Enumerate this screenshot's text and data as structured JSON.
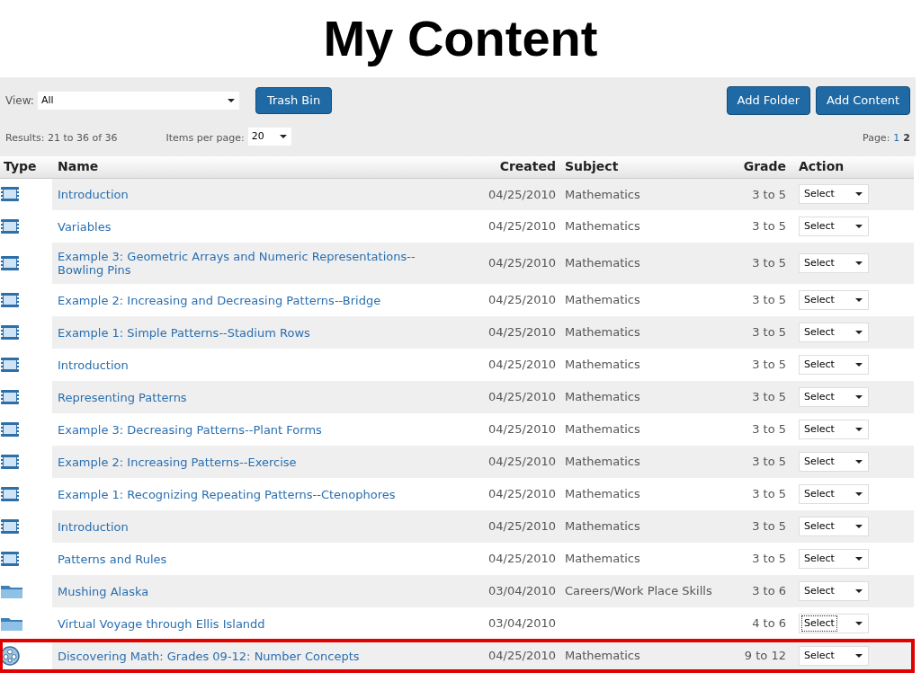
{
  "title": "My Content",
  "toolbar": {
    "view_label": "View:",
    "view_value": "All",
    "trash_button": "Trash Bin",
    "add_folder_button": "Add Folder",
    "add_content_button": "Add Content"
  },
  "results": {
    "text": "Results: 21 to 36 of 36",
    "per_page_label": "Items per page:",
    "per_page_value": "20",
    "page_label": "Page:",
    "pages": [
      {
        "label": "1",
        "selected": false
      },
      {
        "label": "2",
        "selected": true
      }
    ]
  },
  "table": {
    "columns": [
      "Type",
      "Name",
      "Created",
      "Subject",
      "Grade",
      "Action"
    ],
    "rows": [
      {
        "kind": "video",
        "name": "Introduction",
        "created": "04/25/2010",
        "subject": "Mathematics",
        "grade": "3 to 5",
        "action": "Select",
        "focused": false,
        "highlighted": false
      },
      {
        "kind": "video",
        "name": "Variables",
        "created": "04/25/2010",
        "subject": "Mathematics",
        "grade": "3 to 5",
        "action": "Select",
        "focused": false,
        "highlighted": false
      },
      {
        "kind": "video",
        "name": "Example 3: Geometric Arrays and Numeric Representations--Bowling Pins",
        "created": "04/25/2010",
        "subject": "Mathematics",
        "grade": "3 to 5",
        "action": "Select",
        "focused": false,
        "highlighted": false
      },
      {
        "kind": "video",
        "name": "Example 2: Increasing and Decreasing Patterns--Bridge",
        "created": "04/25/2010",
        "subject": "Mathematics",
        "grade": "3 to 5",
        "action": "Select",
        "focused": false,
        "highlighted": false
      },
      {
        "kind": "video",
        "name": "Example 1: Simple Patterns--Stadium Rows",
        "created": "04/25/2010",
        "subject": "Mathematics",
        "grade": "3 to 5",
        "action": "Select",
        "focused": false,
        "highlighted": false
      },
      {
        "kind": "video",
        "name": "Introduction",
        "created": "04/25/2010",
        "subject": "Mathematics",
        "grade": "3 to 5",
        "action": "Select",
        "focused": false,
        "highlighted": false
      },
      {
        "kind": "video",
        "name": "Representing Patterns",
        "created": "04/25/2010",
        "subject": "Mathematics",
        "grade": "3 to 5",
        "action": "Select",
        "focused": false,
        "highlighted": false
      },
      {
        "kind": "video",
        "name": "Example 3: Decreasing Patterns--Plant Forms",
        "created": "04/25/2010",
        "subject": "Mathematics",
        "grade": "3 to 5",
        "action": "Select",
        "focused": false,
        "highlighted": false
      },
      {
        "kind": "video",
        "name": "Example 2: Increasing Patterns--Exercise",
        "created": "04/25/2010",
        "subject": "Mathematics",
        "grade": "3 to 5",
        "action": "Select",
        "focused": false,
        "highlighted": false
      },
      {
        "kind": "video",
        "name": "Example 1: Recognizing Repeating Patterns--Ctenophores",
        "created": "04/25/2010",
        "subject": "Mathematics",
        "grade": "3 to 5",
        "action": "Select",
        "focused": false,
        "highlighted": false
      },
      {
        "kind": "video",
        "name": "Introduction",
        "created": "04/25/2010",
        "subject": "Mathematics",
        "grade": "3 to 5",
        "action": "Select",
        "focused": false,
        "highlighted": false
      },
      {
        "kind": "video",
        "name": "Patterns and Rules",
        "created": "04/25/2010",
        "subject": "Mathematics",
        "grade": "3 to 5",
        "action": "Select",
        "focused": false,
        "highlighted": false
      },
      {
        "kind": "folder",
        "name": "Mushing Alaska",
        "created": "03/04/2010",
        "subject": "Careers/Work Place Skills",
        "grade": "3 to 6",
        "action": "Select",
        "focused": false,
        "highlighted": false
      },
      {
        "kind": "folder",
        "name": "Virtual Voyage through Ellis Islandd",
        "created": "03/04/2010",
        "grade": "4 to 6",
        "action": "Select",
        "focused": true,
        "highlighted": false
      },
      {
        "kind": "disc",
        "name": "Discovering Math: Grades 09-12: Number Concepts",
        "created": "04/25/2010",
        "subject": "Mathematics",
        "grade": "9 to 12",
        "action": "Select",
        "focused": false,
        "highlighted": true
      }
    ]
  }
}
